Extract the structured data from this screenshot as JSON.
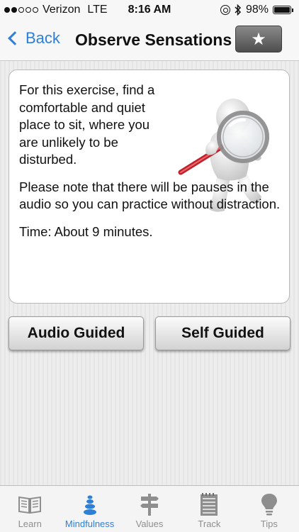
{
  "status_bar": {
    "carrier": "Verizon",
    "network": "LTE",
    "time": "8:16 AM",
    "battery": "98%",
    "battery_level": 0.98,
    "signal_bars_filled": 2,
    "signal_bars_total": 5
  },
  "nav": {
    "back_label": "Back",
    "title": "Observe Sensations",
    "favorite_icon": "★"
  },
  "card": {
    "paragraph_1": "For this exercise, find a comfortable and quiet place to sit, where you are unlikely to be disturbed.",
    "paragraph_2": "Please note that there will be pauses in the audio so you can practice without distraction.",
    "time_text": "Time: About 9 minutes."
  },
  "buttons": {
    "audio_guided": "Audio Guided",
    "self_guided": "Self Guided"
  },
  "tabs": [
    {
      "label": "Learn",
      "icon": "book-icon",
      "active": false
    },
    {
      "label": "Mindfulness",
      "icon": "stones-icon",
      "active": true
    },
    {
      "label": "Values",
      "icon": "signpost-icon",
      "active": false
    },
    {
      "label": "Track",
      "icon": "notepad-icon",
      "active": false
    },
    {
      "label": "Tips",
      "icon": "lightbulb-icon",
      "active": false
    }
  ],
  "colors": {
    "accent": "#2e7fd6",
    "inactive_tab": "#8e8e8e"
  }
}
